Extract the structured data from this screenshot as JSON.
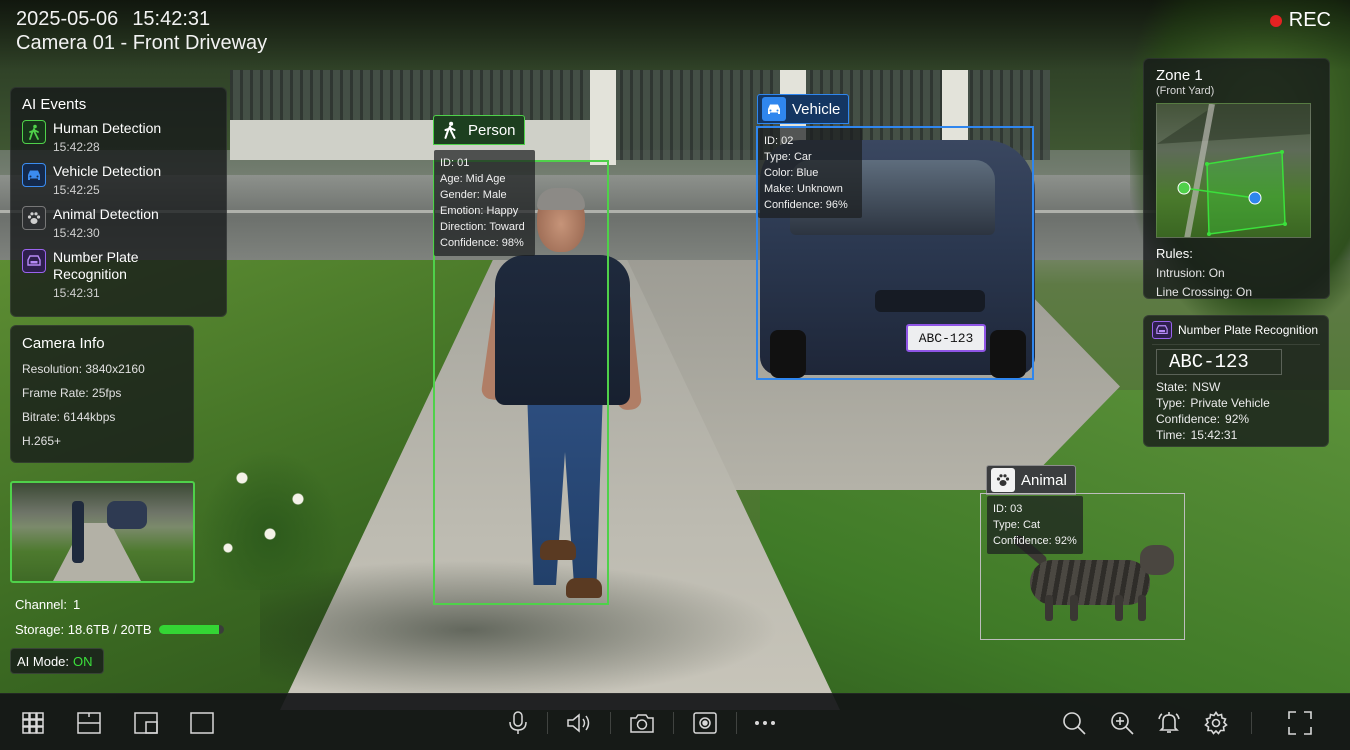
{
  "header": {
    "date": "2025-05-06",
    "time": "15:42:31",
    "camera_title": "Camera 01 - Front Driveway",
    "rec_label": "REC",
    "rec_color": "#e52222"
  },
  "ai_events": {
    "title": "AI Events",
    "items": [
      {
        "label": "Human Detection",
        "time": "15:42:28",
        "icon": "person-walking-icon",
        "color": "#4fd14a"
      },
      {
        "label": "Vehicle Detection",
        "time": "15:42:25",
        "icon": "car-icon",
        "color": "#3b8cf0"
      },
      {
        "label": "Animal Detection",
        "time": "15:42:30",
        "icon": "paw-icon",
        "color": "#cfcfcf"
      },
      {
        "label": "Number Plate Recognition",
        "time": "15:42:31",
        "icon": "plate-icon",
        "color": "#9a63ee"
      }
    ]
  },
  "camera_info": {
    "title": "Camera Info",
    "resolution": "Resolution: 3840x2160",
    "frame_rate": "Frame Rate: 25fps",
    "bitrate": "Bitrate: 6144kbps",
    "codec": "H.265+"
  },
  "status": {
    "channel_label": "Channel:",
    "channel_value": "1",
    "storage_label": "Storage:",
    "storage_value": "18.6TB / 20TB",
    "storage_fraction": 0.93,
    "ai_mode_label": "AI Mode:",
    "ai_mode_value": "ON"
  },
  "detections": {
    "person": {
      "tag": "Person",
      "color": "#4fd14a",
      "lines": [
        "ID: 01",
        "Age: Mid Age",
        "Gender: Male",
        "Emotion: Happy",
        "Direction: Toward",
        "Confidence: 98%"
      ]
    },
    "vehicle": {
      "tag": "Vehicle",
      "color": "#2f86ee",
      "lines": [
        "ID: 02",
        "Type: Car",
        "Color: Blue",
        "Make: Unknown",
        "Confidence: 96%"
      ],
      "plate": "ABC-123"
    },
    "animal": {
      "tag": "Animal",
      "color": "#bdbdbd",
      "lines": [
        "ID: 03",
        "Type: Cat",
        "Confidence: 92%"
      ]
    }
  },
  "zone": {
    "title": "Zone 1",
    "subtitle": "(Front Yard)",
    "rules_title": "Rules:",
    "intrusion": "Intrusion: On",
    "line_crossing": "Line Crossing: On"
  },
  "npr": {
    "title": "Number Plate Recognition",
    "plate": "ABC-123",
    "state_k": "State:",
    "state_v": "NSW",
    "type_k": "Type:",
    "type_v": "Private Vehicle",
    "conf_k": "Confidence:",
    "conf_v": "92%",
    "time_k": "Time:",
    "time_v": "15:42:31"
  },
  "toolbar": {
    "left": [
      "grid-4-icon",
      "split-horizontal-icon",
      "picture-in-picture-icon",
      "single-view-icon"
    ],
    "center": [
      "microphone-icon",
      "speaker-icon",
      "snapshot-camera-icon",
      "record-icon",
      "more-icon"
    ],
    "right": [
      "search-icon",
      "zoom-in-icon",
      "alarm-bell-icon",
      "settings-gear-icon",
      "fullscreen-icon"
    ]
  }
}
